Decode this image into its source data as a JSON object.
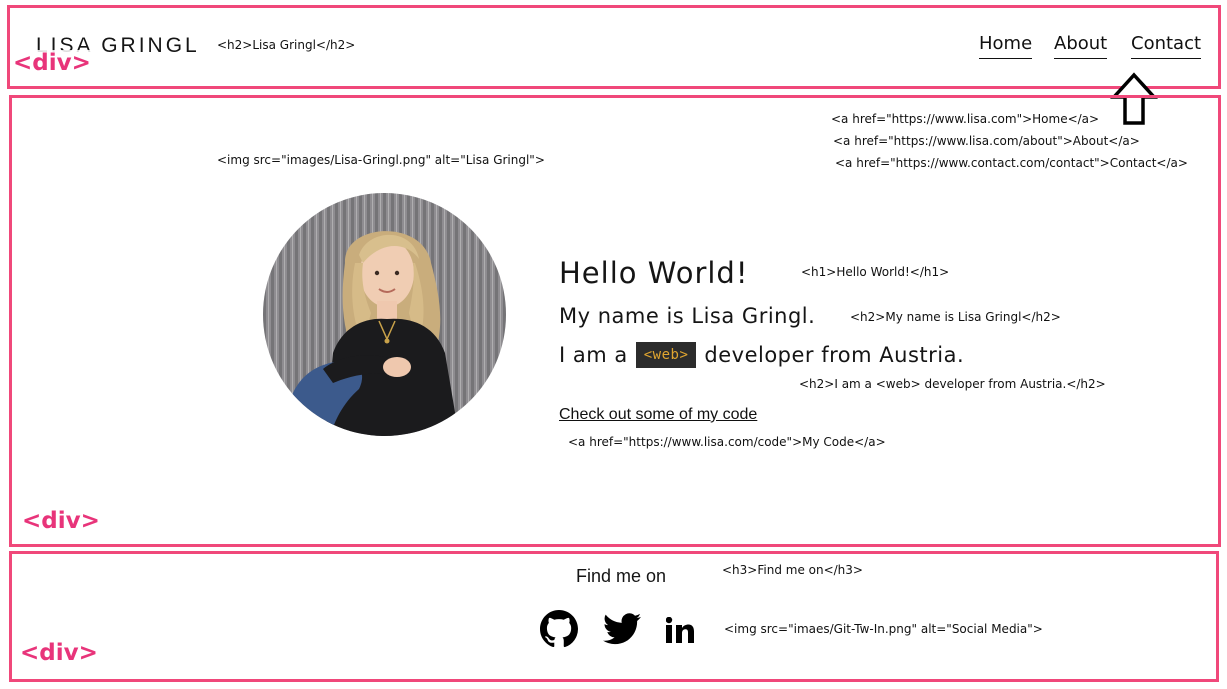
{
  "header": {
    "logo": "LISA GRINGL",
    "logo_annotation": "<h2>Lisa Gringl</h2>",
    "nav": [
      {
        "label": "Home"
      },
      {
        "label": "About"
      },
      {
        "label": "Contact"
      }
    ],
    "nav_annotations": [
      "<a href=\"https://www.lisa.com\">Home</a>",
      "<a href=\"https://www.lisa.com/about\">About</a>",
      "<a href=\"https://www.contact.com/contact\">Contact</a>"
    ],
    "div_tag": "<div>"
  },
  "hero": {
    "img_annotation": "<img src=\"images/Lisa-Gringl.png\" alt=\"Lisa Gringl\">",
    "h1": "Hello World!",
    "h1_annotation": "<h1>Hello World!</h1>",
    "h2_name": "My name is Lisa Gringl.",
    "h2_name_annotation": "<h2>My name is Lisa Gringl</h2>",
    "h2_intro_before": "I am a",
    "h2_intro_tag": "<web>",
    "h2_intro_after": "developer from Austria.",
    "h2_intro_annotation": "<h2>I am a <web> developer from Austria.</h2>",
    "code_link": "Check out some of my code",
    "code_link_annotation": "<a href=\"https://www.lisa.com/code\">My Code</a>",
    "div_tag": "<div>"
  },
  "footer": {
    "heading": "Find me on",
    "heading_annotation": "<h3>Find me on</h3>",
    "social_icons": [
      "github-icon",
      "twitter-icon",
      "linkedin-icon"
    ],
    "social_annotation": "<img src=\"imaes/Git-Tw-In.png\" alt=\"Social Media\">",
    "div_tag": "<div>"
  },
  "colors": {
    "box_border": "#f0487a",
    "div_label": "#e8347a",
    "web_tag_bg": "#2c2c2c",
    "web_tag_text": "#e0a530"
  }
}
